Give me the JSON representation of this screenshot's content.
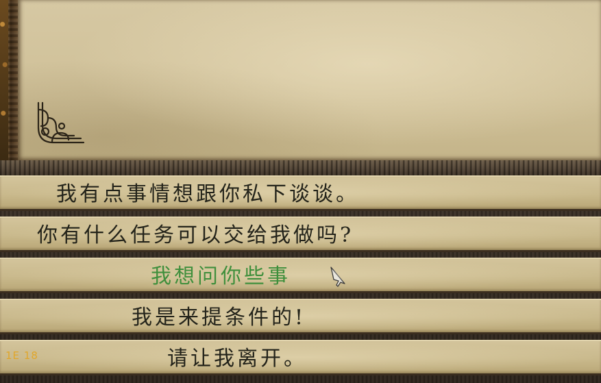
{
  "dialogue": {
    "options": [
      {
        "label": "我有点事情想跟你私下谈谈。",
        "highlighted": false
      },
      {
        "label": "你有什么任务可以交给我做吗?",
        "highlighted": false
      },
      {
        "label": "我想问你些事",
        "highlighted": true
      },
      {
        "label": "我是来提条件的!",
        "highlighted": false
      },
      {
        "label": "请让我离开。",
        "highlighted": false
      }
    ]
  },
  "hud": {
    "badge_text": "1E 18"
  },
  "icons": {
    "corner": "celtic-knot-corner-icon",
    "cursor": "quill-cursor-icon"
  },
  "colors": {
    "text": "#23231a",
    "highlight": "#3f8f3c",
    "parchment": "#d3c49b",
    "badge": "#e1a62a"
  }
}
